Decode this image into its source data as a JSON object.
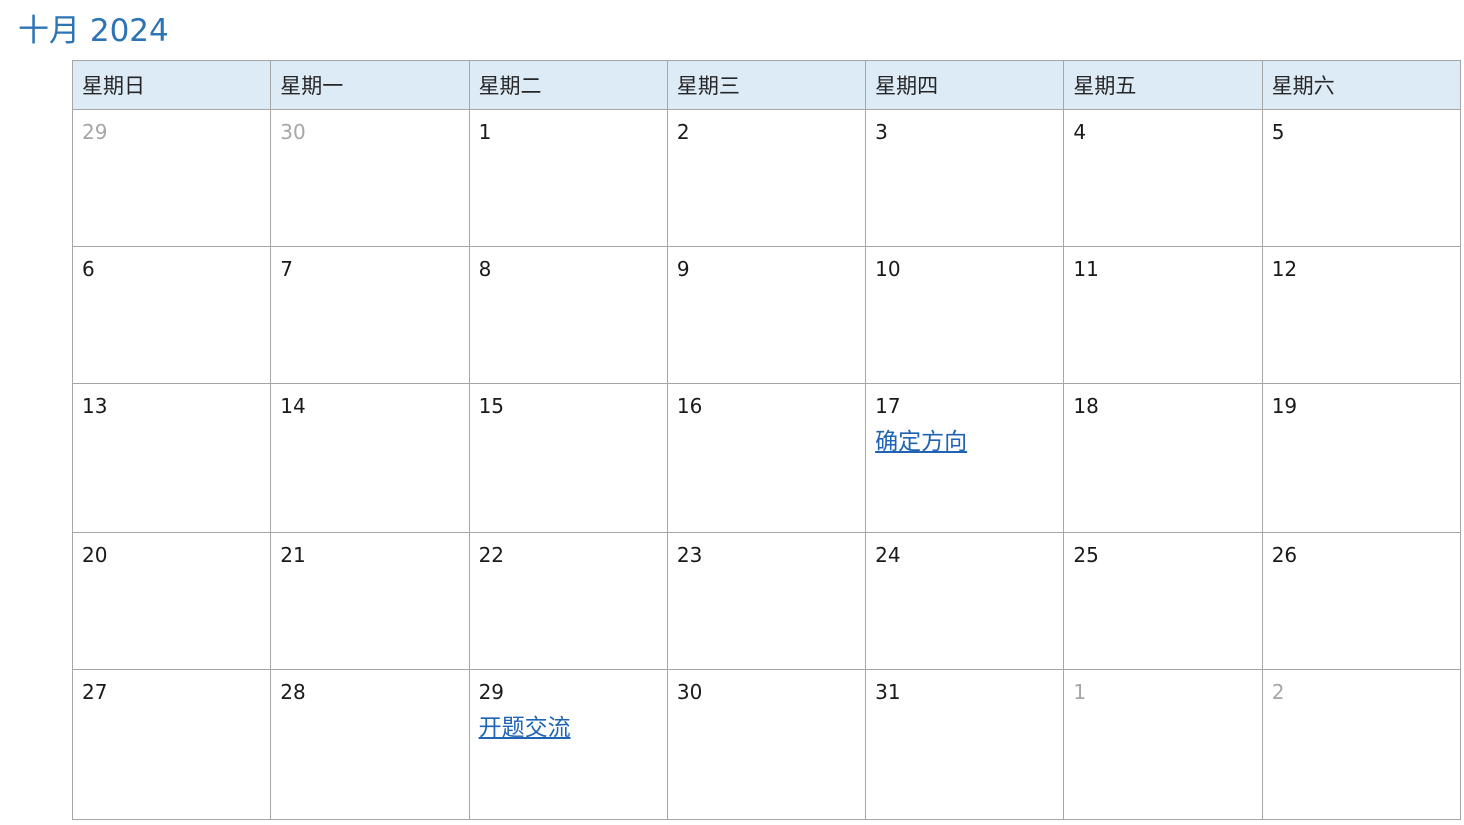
{
  "title": "十月 2024",
  "weekdays": [
    "星期日",
    "星期一",
    "星期二",
    "星期三",
    "星期四",
    "星期五",
    "星期六"
  ],
  "weeks": [
    [
      {
        "day": "29",
        "muted": true
      },
      {
        "day": "30",
        "muted": true
      },
      {
        "day": "1"
      },
      {
        "day": "2"
      },
      {
        "day": "3"
      },
      {
        "day": "4"
      },
      {
        "day": "5"
      }
    ],
    [
      {
        "day": "6"
      },
      {
        "day": "7"
      },
      {
        "day": "8"
      },
      {
        "day": "9"
      },
      {
        "day": "10"
      },
      {
        "day": "11"
      },
      {
        "day": "12"
      }
    ],
    [
      {
        "day": "13"
      },
      {
        "day": "14"
      },
      {
        "day": "15"
      },
      {
        "day": "16"
      },
      {
        "day": "17",
        "event": "确定方向"
      },
      {
        "day": "18"
      },
      {
        "day": "19"
      }
    ],
    [
      {
        "day": "20"
      },
      {
        "day": "21"
      },
      {
        "day": "22"
      },
      {
        "day": "23"
      },
      {
        "day": "24"
      },
      {
        "day": "25"
      },
      {
        "day": "26"
      }
    ],
    [
      {
        "day": "27"
      },
      {
        "day": "28"
      },
      {
        "day": "29",
        "event": "开题交流"
      },
      {
        "day": "30"
      },
      {
        "day": "31"
      },
      {
        "day": "1",
        "muted": true
      },
      {
        "day": "2",
        "muted": true
      }
    ]
  ],
  "colors": {
    "title": "#2e74b5",
    "header_bg": "#ddebf7",
    "grid_border": "#a6a6a6",
    "muted_day": "#a6a6a6",
    "event_link": "#1f64b4"
  }
}
